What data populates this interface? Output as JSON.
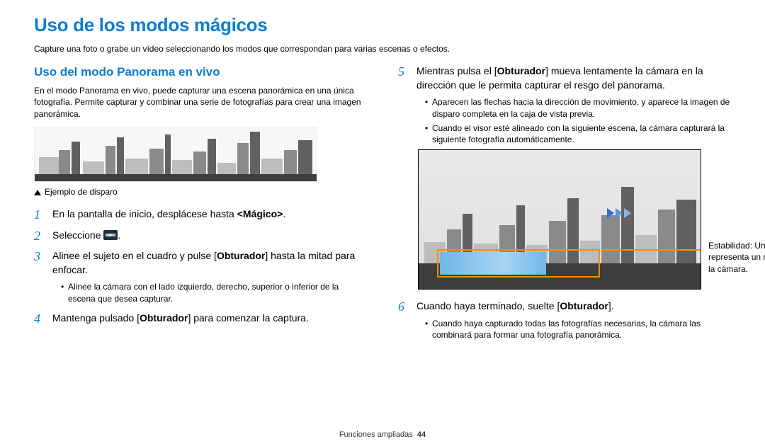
{
  "page_title": "Uso de los modos mágicos",
  "intro": "Capture una foto o grabe un vídeo seleccionando los modos que correspondan para varias escenas o efectos.",
  "section_title": "Uso del modo Panorama en vivo",
  "section_desc": "En el modo Panorama en vivo, puede capturar una escena panorámica en una única fotografía. Permite capturar y combinar una serie de fotografías para crear una imagen panorámica.",
  "example_caption": "Ejemplo de disparo",
  "steps_left": {
    "s1_pre": "En la pantalla de inicio, desplácese hasta ",
    "s1_bold": "<Mágico>",
    "s1_post": ".",
    "s2_pre": "Seleccione ",
    "s2_post": ".",
    "s3_pre": "Alinee el sujeto en el cuadro y pulse [",
    "s3_bold": "Obturador",
    "s3_post": "] hasta la mitad para enfocar.",
    "s3_bullet1": "Alinee la cámara con el lado izquierdo, derecho, superior o inferior de la escena que desea capturar.",
    "s4_pre": "Mantenga pulsado [",
    "s4_bold": "Obturador",
    "s4_post": "] para comenzar la captura."
  },
  "steps_right": {
    "s5_pre": "Mientras pulsa el [",
    "s5_bold": "Obturador",
    "s5_post": "] mueva lentamente la cámara en la dirección que le permita capturar el resgo del panorama.",
    "s5_bullet1": "Aparecen las flechas hacia la dirección de movimiento, y aparece la imagen de disparo completa en la caja de vista previa.",
    "s5_bullet2": "Cuando el visor esté alineado con la siguiente escena, la cámara capturará la siguiente fotografía automáticamente.",
    "callout": "Estabilidad: Una línea más plana representa un menor movimiento de la cámara.",
    "s6_pre": "Cuando haya terminado, suelte [",
    "s6_bold": "Obturador",
    "s6_post": "].",
    "s6_bullet1": "Cuando haya capturado todas las fotografías necesarias, la cámara las combinará para formar una fotografía panorámica."
  },
  "footer_section": "Funciones ampliadas",
  "footer_page": "44"
}
